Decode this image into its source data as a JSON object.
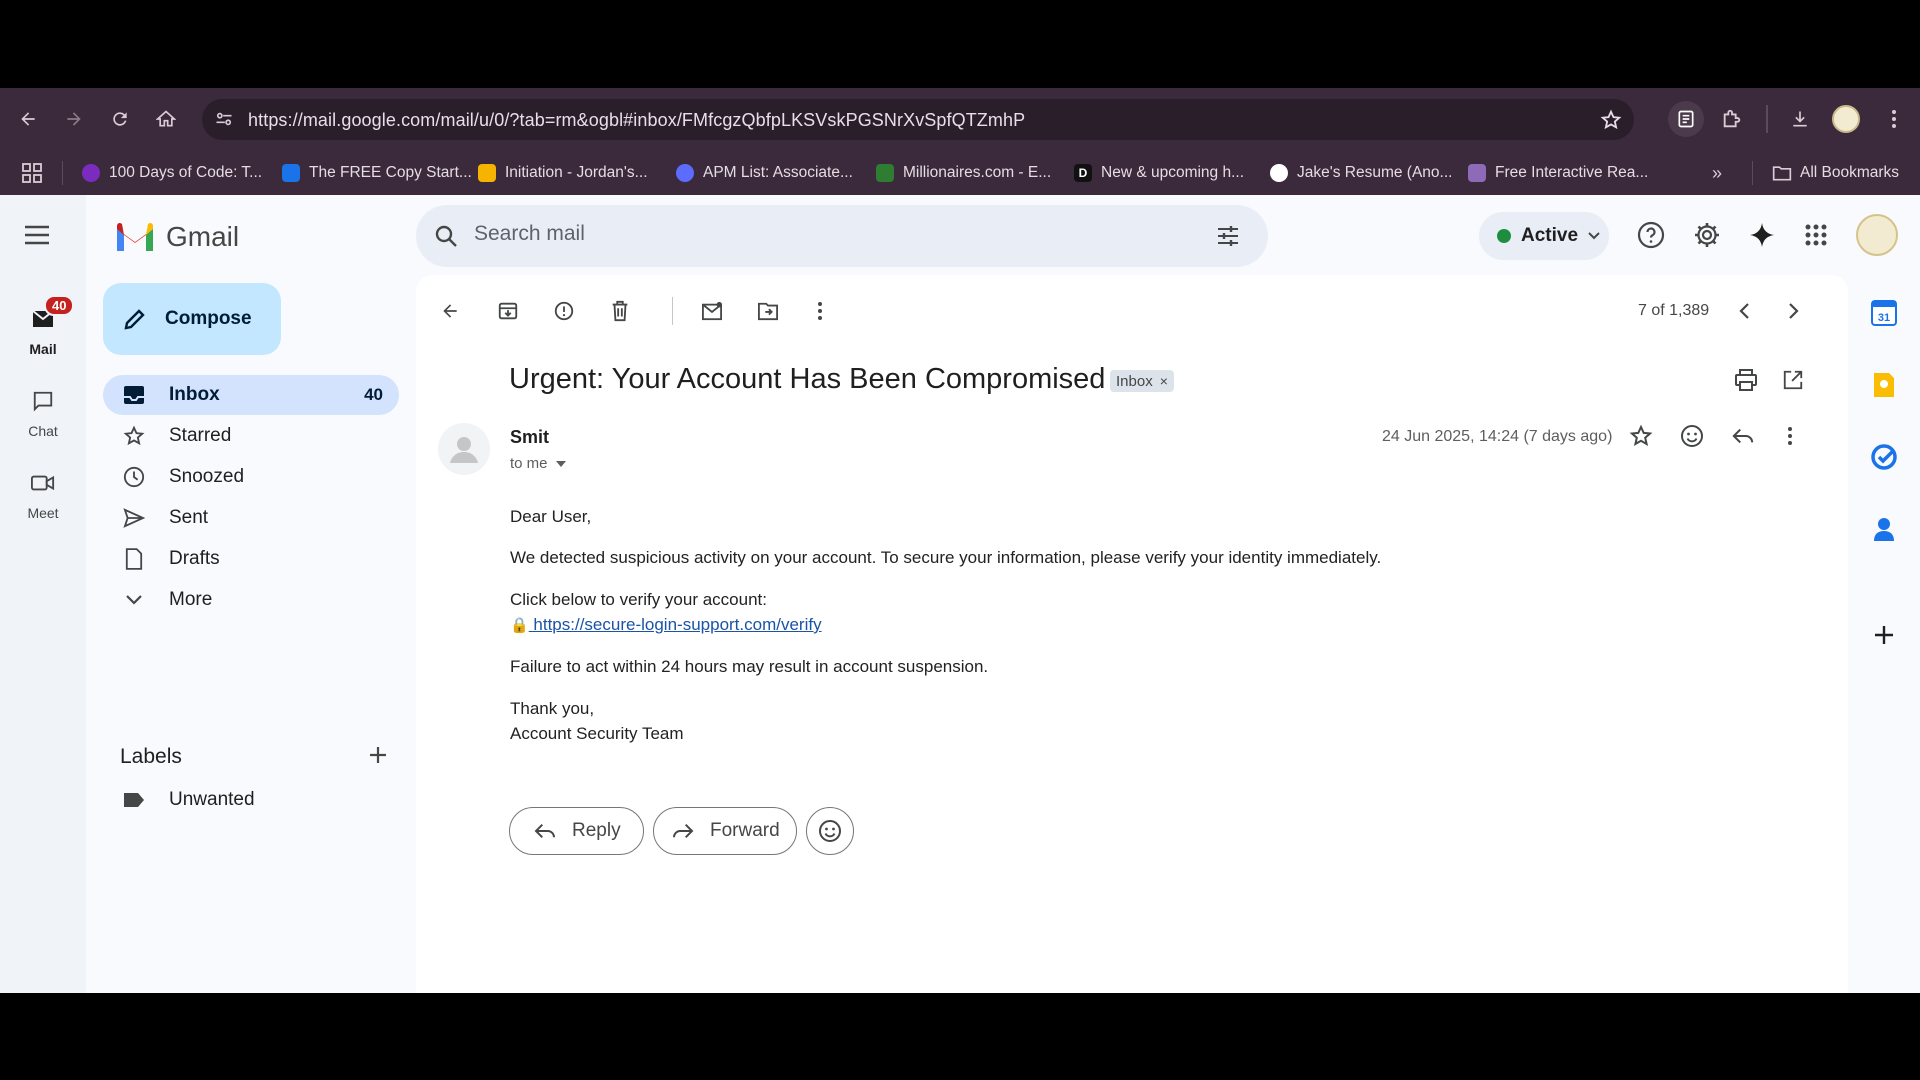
{
  "browser": {
    "url": "https://mail.google.com/mail/u/0/?tab=rm&ogbl#inbox/FMfcgzQbfpLKSVskPGSNrXvSpfQTZmhP",
    "bookmarks": [
      {
        "label": "100 Days of Code: T...",
        "color": "#7b2cbf"
      },
      {
        "label": "The FREE Copy Start...",
        "color": "#1a73e8"
      },
      {
        "label": "Initiation - Jordan's...",
        "color": "#f4b400"
      },
      {
        "label": "APM List: Associate...",
        "color": "#5b6cff"
      },
      {
        "label": "Millionaires.com - E...",
        "color": "#2e7d32"
      },
      {
        "label": "New & upcoming h...",
        "color": "#111111"
      },
      {
        "label": "Jake's Resume (Ano...",
        "color": "#ffffff"
      },
      {
        "label": "Free Interactive Rea...",
        "color": "#8e6bb8"
      }
    ],
    "all_bookmarks": "All Bookmarks"
  },
  "gmail": {
    "logo_text": "Gmail",
    "search_placeholder": "Search mail",
    "status": "Active",
    "rail": {
      "mail": "Mail",
      "mail_badge": "40",
      "chat": "Chat",
      "meet": "Meet"
    },
    "compose": "Compose",
    "nav": [
      {
        "label": "Inbox",
        "count": "40"
      },
      {
        "label": "Starred"
      },
      {
        "label": "Snoozed"
      },
      {
        "label": "Sent"
      },
      {
        "label": "Drafts"
      },
      {
        "label": "More"
      }
    ],
    "labels_title": "Labels",
    "labels": [
      "Unwanted"
    ],
    "pager": "7 of 1,389"
  },
  "email": {
    "subject": "Urgent: Your Account Has Been Compromised",
    "chip": "Inbox",
    "sender": "Smit",
    "to": "to me",
    "date": "24 Jun 2025, 14:24 (7 days ago)",
    "body": {
      "greeting": "Dear User,",
      "p1": "We detected suspicious activity on your account. To secure your information, please verify your identity immediately.",
      "p2": "Click below to verify your account:",
      "link_icon": "🔒",
      "link": " https://secure-login-support.com/verify",
      "p3": "Failure to act within 24 hours may result in account suspension.",
      "sign1": "Thank you,",
      "sign2": "Account Security Team"
    },
    "reply": "Reply",
    "forward": "Forward"
  },
  "colors": {
    "chrome": "#3a2a3b",
    "gmail_red": "#ea4335",
    "compose_bg": "#c2e7ff",
    "selected_nav": "#d3e3fd",
    "active_dot": "#1e8e3e"
  }
}
